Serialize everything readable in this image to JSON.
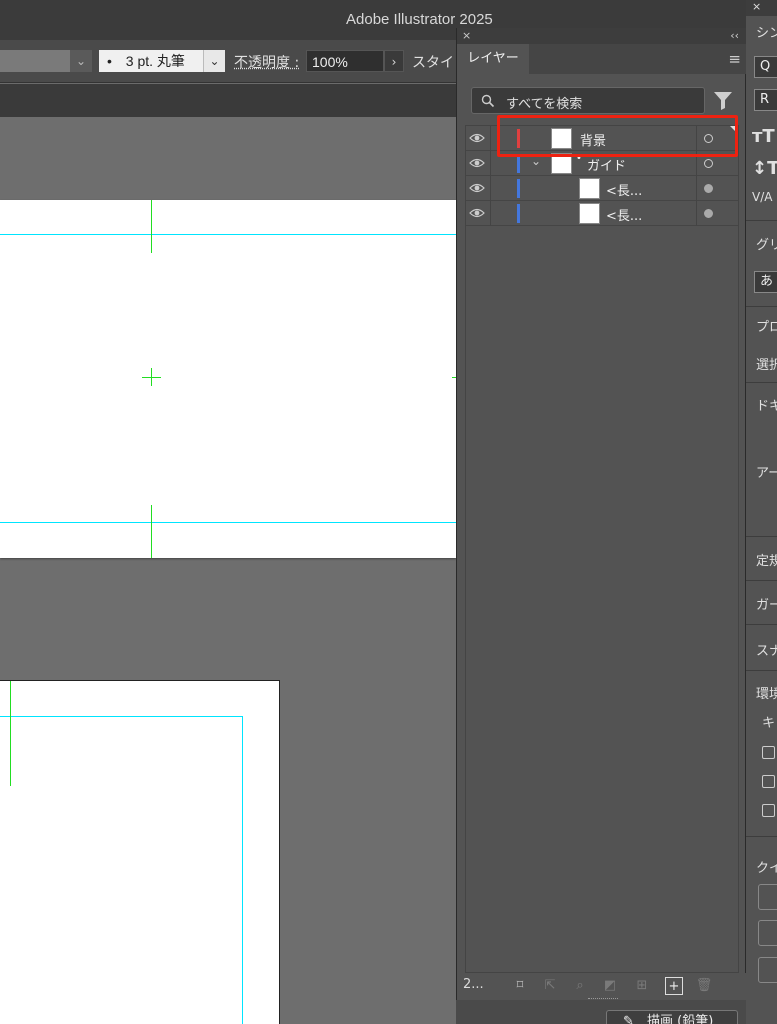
{
  "app": {
    "title": "Adobe Illustrator 2025"
  },
  "control_bar": {
    "brush": "3 pt. 丸筆",
    "brush_bullet": "•",
    "opacity_label": "不透明度 :",
    "opacity_value": "100%",
    "style_label": "スタイ"
  },
  "layers_panel": {
    "close": "×",
    "collapse": "‹‹",
    "tab": "レイヤー",
    "menu": "≡",
    "search_placeholder": "すべてを検索",
    "rows": [
      {
        "name": "背景",
        "color": "#e04040",
        "visible": true
      },
      {
        "name": "ガイド",
        "color": "#4477dd",
        "visible": true,
        "expanded": true
      },
      {
        "name": "<長...",
        "color": "#4477dd",
        "visible": true
      },
      {
        "name": "<長...",
        "color": "#4477dd",
        "visible": true
      }
    ],
    "layer_count": "2..."
  },
  "right_panel": {
    "close": "×",
    "tab": "シン",
    "search_prefix": "Q",
    "font_field": "R",
    "grid_label": "グリ",
    "char_box": "あ",
    "properties_label": "プロ",
    "selection_label": "選択",
    "document_label": "ドキ",
    "artboard_label": "アー",
    "ruler_label": "定規",
    "guide_label": "ガー",
    "snap_label": "スナ",
    "prefs_label": "環境",
    "key_label": "キ",
    "quick_label": "クイ"
  },
  "bottom_button": {
    "label": "描画 (鉛筆)"
  },
  "accent": {
    "highlight": "#ee2211",
    "guide": "#00e5ff",
    "crop": "#22dd22"
  }
}
